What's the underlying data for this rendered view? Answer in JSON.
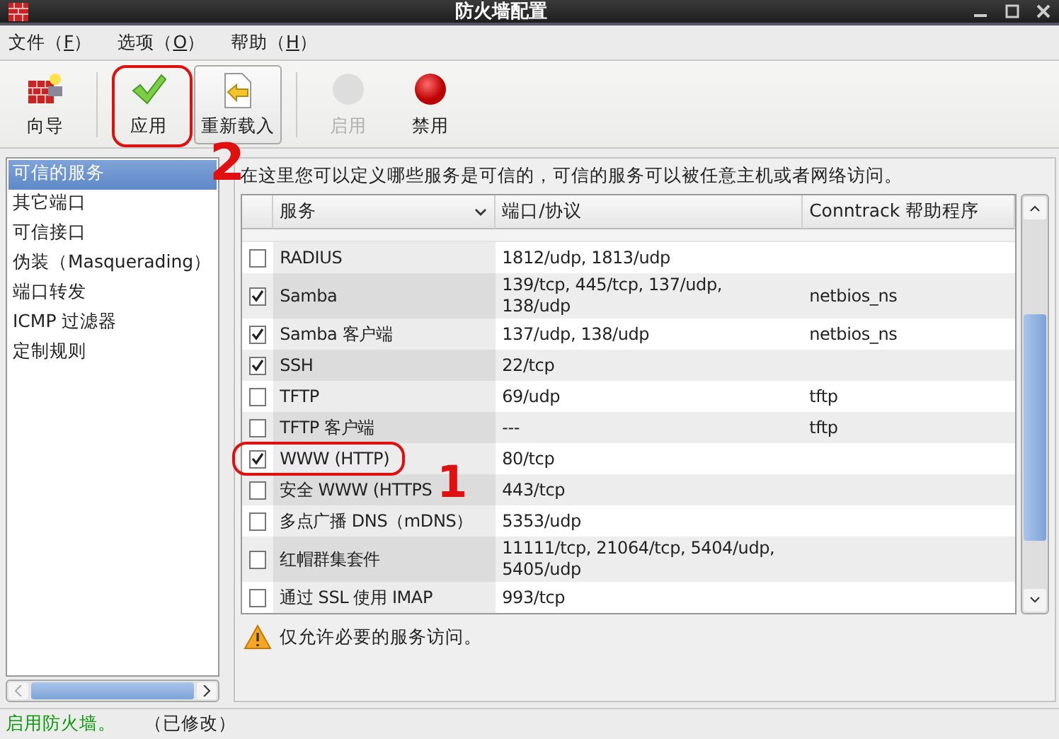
{
  "window": {
    "title": "防火墙配置"
  },
  "menu": [
    {
      "label": "文件（",
      "key": "F",
      "suffix": "）"
    },
    {
      "label": "选项（",
      "key": "O",
      "suffix": "）"
    },
    {
      "label": "帮助（",
      "key": "H",
      "suffix": "）"
    }
  ],
  "toolbar": [
    {
      "kind": "wizard",
      "label": "向导",
      "disabled": false,
      "hovered": false
    },
    {
      "kind": "apply",
      "label": "应用",
      "disabled": false,
      "hovered": false
    },
    {
      "kind": "reload",
      "label": "重新载入",
      "disabled": false,
      "hovered": true
    },
    {
      "kind": "enable",
      "label": "启用",
      "disabled": true,
      "hovered": false
    },
    {
      "kind": "disable",
      "label": "禁用",
      "disabled": false,
      "hovered": false
    }
  ],
  "sidebar": {
    "items": [
      {
        "label": "可信的服务",
        "selected": true
      },
      {
        "label": "其它端口",
        "selected": false
      },
      {
        "label": "可信接口",
        "selected": false
      },
      {
        "label": "伪装（Masquerading）",
        "selected": false
      },
      {
        "label": "端口转发",
        "selected": false
      },
      {
        "label": "ICMP 过滤器",
        "selected": false
      },
      {
        "label": "定制规则",
        "selected": false
      }
    ]
  },
  "description": "在这里您可以定义哪些服务是可信的，可信的服务可以被任意主机或者网络访问。",
  "table": {
    "columns": [
      "服务",
      "端口/协议",
      "Conntrack 帮助程序"
    ],
    "rows": [
      {
        "checked": false,
        "service": "RADIUS",
        "ports": "1812/udp, 1813/udp"
      },
      {
        "checked": true,
        "service": "Samba",
        "ports": "139/tcp, 445/tcp, 137/udp, 138/udp",
        "helper": "netbios_ns"
      },
      {
        "checked": true,
        "service": "Samba 客户端",
        "ports": "137/udp, 138/udp",
        "helper": "netbios_ns"
      },
      {
        "checked": true,
        "service": "SSH",
        "ports": "22/tcp"
      },
      {
        "checked": false,
        "service": "TFTP",
        "ports": "69/udp",
        "helper": "tftp"
      },
      {
        "checked": false,
        "service": "TFTP 客户端",
        "ports": "---",
        "helper": "tftp"
      },
      {
        "checked": true,
        "service": "WWW (HTTP)",
        "ports": "80/tcp"
      },
      {
        "checked": false,
        "service": "安全 WWW (HTTPS",
        "ports": "443/tcp"
      },
      {
        "checked": false,
        "service": "多点广播 DNS（mDNS）",
        "ports": "5353/udp"
      },
      {
        "checked": false,
        "service": "红帽群集套件",
        "ports": "11111/tcp, 21064/tcp, 5404/udp, 5405/udp"
      },
      {
        "checked": false,
        "service": "通过 SSL 使用 IMAP",
        "ports": "993/tcp"
      }
    ]
  },
  "warning": "仅允许必要的服务访问。",
  "status_bar": {
    "state": "启用防火墙。",
    "modified": "（已修改）"
  },
  "annotations": [
    {
      "label": "2"
    },
    {
      "label": "1"
    }
  ]
}
